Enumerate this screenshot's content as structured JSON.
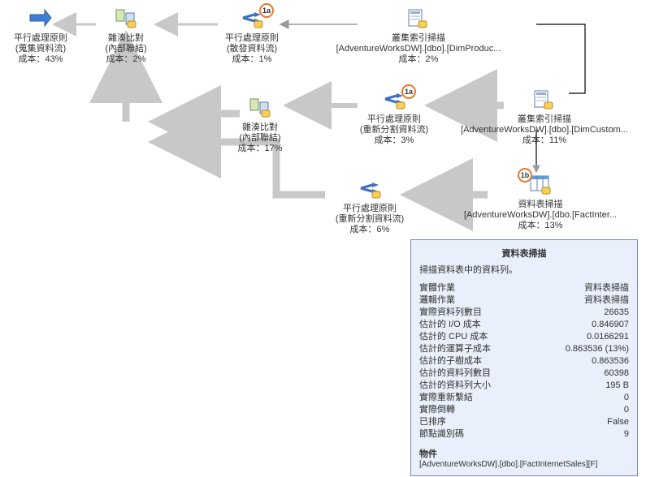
{
  "nodes": {
    "n0": {
      "title": "平行處理原則",
      "sub": "(蒐集資料流)",
      "cost": "成本：43%"
    },
    "n1": {
      "title": "雜湊比對",
      "sub": "(內部聯結)",
      "cost": "成本：2%"
    },
    "n2": {
      "title": "平行處理原則",
      "sub": "(散發資料流)",
      "cost": "成本：1%",
      "badge": "1a"
    },
    "n3": {
      "title": "叢集索引掃描",
      "sub": "[AdventureWorksDW].[dbo].[DimProduc...",
      "cost": "成本：2%"
    },
    "n4": {
      "title": "雜湊比對",
      "sub": "(內部聯結)",
      "cost": "成本：17%"
    },
    "n5": {
      "title": "平行處理原則",
      "sub": "(重新分割資料流)",
      "cost": "成本：3%",
      "badge": "1a"
    },
    "n6": {
      "title": "叢集索引掃描",
      "sub": "[AdventureWorksDW].[dbo].[DimCustom...",
      "cost": "成本：11%"
    },
    "n7": {
      "title": "平行處理原則",
      "sub": "(重新分割資料流)",
      "cost": "成本：6%"
    },
    "n8": {
      "title": "資料表掃描",
      "sub": "[AdventureWorksDW].[dbo.[FactInter...",
      "cost": "成本：13%",
      "badge": "1b"
    }
  },
  "tooltip": {
    "title": "資料表掃描",
    "subtitle": "掃描資料表中的資料列。",
    "rows": [
      {
        "k": "實體作業",
        "v": "資料表掃描"
      },
      {
        "k": "邏輯作業",
        "v": "資料表掃描"
      },
      {
        "k": "實際資料列數目",
        "v": "26635"
      },
      {
        "k": "估計的 I/O 成本",
        "v": "0.846907"
      },
      {
        "k": "估計的 CPU 成本",
        "v": "0.0166291"
      },
      {
        "k": "估計的運算子成本",
        "v": "0.863536 (13%)"
      },
      {
        "k": "估計的子樹成本",
        "v": "0.863536"
      },
      {
        "k": "估計的資料列數目",
        "v": "60398"
      },
      {
        "k": "估計的資料列大小",
        "v": "195 B"
      },
      {
        "k": "實際重新繫結",
        "v": "0"
      },
      {
        "k": "實際倒轉",
        "v": "0"
      },
      {
        "k": "已排序",
        "v": "False"
      },
      {
        "k": "節點識別碼",
        "v": "9"
      }
    ],
    "object_label": "物件",
    "object_value": "[AdventureWorksDW].[dbo].[FactInternetSales][F]"
  }
}
